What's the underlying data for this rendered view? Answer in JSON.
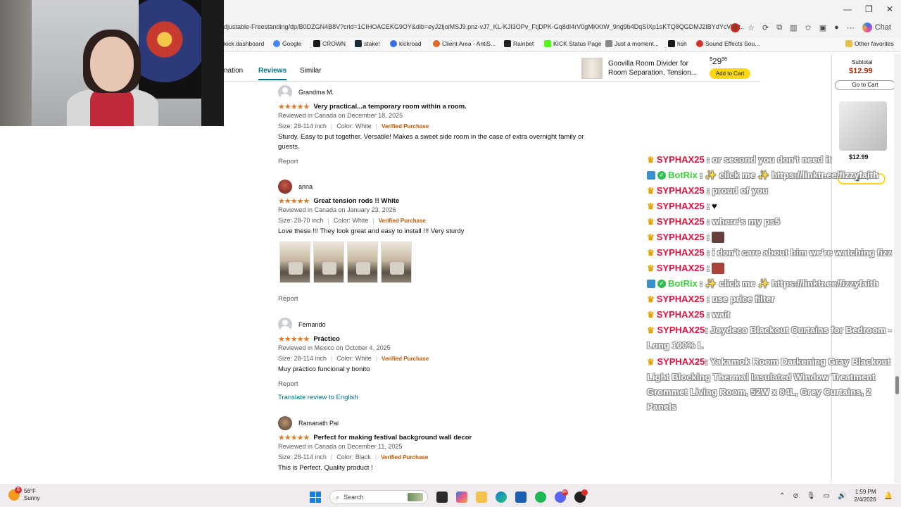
{
  "browser": {
    "url": "djustable-Freestanding/dp/B0DZGN4B8V?crid=1CIHOACEKG9OY&dib=eyJ2IjoiMSJ9.pnz-vJ7_KL-KJI3OPv_FtjDPK-Gq8dI4rV0gMKKtW_9ng9b4DqSIXp1sKTQ8QGDMJ2IBYdYcVBbt...",
    "chat_button": "Chat",
    "ext_badge": "6"
  },
  "bookmarks": [
    {
      "label": "kick dashboard",
      "color": "#53fc18"
    },
    {
      "label": "Google",
      "color": "#4285f4"
    },
    {
      "label": "CROWN",
      "color": "#1a1a1a"
    },
    {
      "label": "stake!",
      "color": "#1a2c38"
    },
    {
      "label": "kickroad",
      "color": "#3a6ee8"
    },
    {
      "label": "Client Area - AntiS...",
      "color": "#e06a2b"
    },
    {
      "label": "Rainbet",
      "color": "#222222"
    },
    {
      "label": "KICK Status Page",
      "color": "#53fc18"
    },
    {
      "label": "Just a moment...",
      "color": "#888888"
    },
    {
      "label": "hsh",
      "color": "#1a1a1a"
    },
    {
      "label": "Sound Effects Sou...",
      "color": "#d6322b"
    }
  ],
  "other_favorites": "Other favorites",
  "page_nav": {
    "tabs": [
      "nation",
      "Reviews",
      "Similar"
    ],
    "active": "Reviews",
    "promo_title": "Goovilla Room Divider for Room Separation, Tension...",
    "promo_price_whole": "29",
    "promo_price_frac": "98",
    "promo_currency": "$",
    "add_to_cart": "Add to Cart"
  },
  "side_cart": {
    "subtotal_label": "Subtotal",
    "subtotal": "$12.99",
    "go_to_cart": "Go to Cart",
    "item_price": "$12.99"
  },
  "reviews": [
    {
      "name": "Grandma M.",
      "avatar": "default",
      "stars": "★★★★★",
      "title": "Very practical...a temporary room within a room.",
      "meta": "Reviewed in Canada on December 18, 2025",
      "size": "Size: 28-114 inch",
      "color": "Color: White",
      "verified": "Verified Purchase",
      "body": "Sturdy. Easy to put together. Versatile! Makes a sweet side room in the case of extra overnight family or guests.",
      "report": "Report"
    },
    {
      "name": "anna",
      "avatar": "red",
      "stars": "★★★★★",
      "title": "Great tension rods !! White",
      "meta": "Reviewed in Canada on January 23, 2026",
      "size": "Size: 28-70 inch",
      "color": "Color: White",
      "verified": "Verified Purchase",
      "body": "Love these !!! They look great and easy to install !!! Very sturdy",
      "photos": 4,
      "report": "Report"
    },
    {
      "name": "Fernando",
      "avatar": "default",
      "stars": "★★★★★",
      "title": "Práctico",
      "meta": "Reviewed in Mexico on October 4, 2025",
      "size": "Size: 28-114 inch",
      "color": "Color: White",
      "verified": "Verified Purchase",
      "body": "Muy práctico funcional y bonito",
      "report": "Report",
      "translate": "Translate review to English"
    },
    {
      "name": "Ramanath Pai",
      "avatar": "man",
      "stars": "★★★★★",
      "title": "Perfect for making festival background wall decor",
      "meta": "Reviewed in Canada on December 11, 2025",
      "size": "Size: 28-114 inch",
      "color": "Color: Black",
      "verified": "Verified Purchase",
      "body": "This is Perfect. Quality product !",
      "report": "Report"
    }
  ],
  "chat": [
    {
      "user": "SYPHAX25",
      "type": "user",
      "text": ": or second you don't need it"
    },
    {
      "user": "BotRix",
      "type": "bot",
      "text": ": ✨ click me ✨ https://linktr.ee/fizzyfaith"
    },
    {
      "user": "SYPHAX25",
      "type": "user",
      "text": ": proud of you"
    },
    {
      "user": "SYPHAX25",
      "type": "user",
      "text": ": ",
      "emote": "heart"
    },
    {
      "user": "SYPHAX25",
      "type": "user",
      "text": ": where's my ps5"
    },
    {
      "user": "SYPHAX25",
      "type": "user",
      "text": ": ",
      "emote": "img1"
    },
    {
      "user": "SYPHAX25",
      "type": "user",
      "text": ": i don't care about him we're watching fizz"
    },
    {
      "user": "SYPHAX25",
      "type": "user",
      "text": ": ",
      "emote": "img2"
    },
    {
      "user": "BotRix",
      "type": "bot",
      "text": ": ✨ click me ✨ https://linktr.ee/fizzyfaith"
    },
    {
      "user": "SYPHAX25",
      "type": "user",
      "text": ": use price filter"
    },
    {
      "user": "SYPHAX25",
      "type": "user",
      "text": ": wait"
    },
    {
      "user": "SYPHAX25",
      "type": "user",
      "text": ": Joydeco Blackout Curtains for Bedroom - Long 100% L",
      "wrap": true
    },
    {
      "user": "SYPHAX25",
      "type": "user",
      "text": ": Yakamok Room Darkening Gray Blackout Light Blocking Thermal Insulated Window Treatment Grommet Living Room, 52W x 84L, Grey Curtains, 2 Panels",
      "wrap": true
    }
  ],
  "taskbar": {
    "temp": "56°F",
    "condition": "Sunny",
    "weather_badge": "6",
    "search": "Search",
    "time": "1:59 PM",
    "date": "2/4/2026",
    "discord_badge": "99+"
  }
}
